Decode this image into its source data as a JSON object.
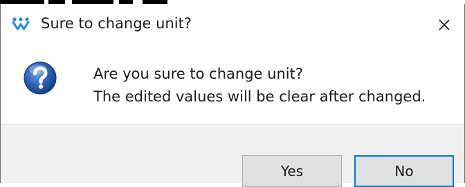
{
  "dialog": {
    "title": "Sure to change unit?",
    "close_glyph": "×",
    "app_icon": "gowin-logo-icon",
    "message_icon": "question-icon",
    "message_line_1": "Are you sure to change unit?",
    "message_line_2": "The edited values will be clear after changed.",
    "yes_label": "Yes",
    "no_label": "No",
    "default_button": "No"
  },
  "colors": {
    "focus_border": "#0078d7",
    "footer_bg": "#f0f0f0",
    "button_bg": "#e1e1e1",
    "question_icon_blue": "#2b5fb4",
    "logo_blue": "#1e88e5"
  }
}
